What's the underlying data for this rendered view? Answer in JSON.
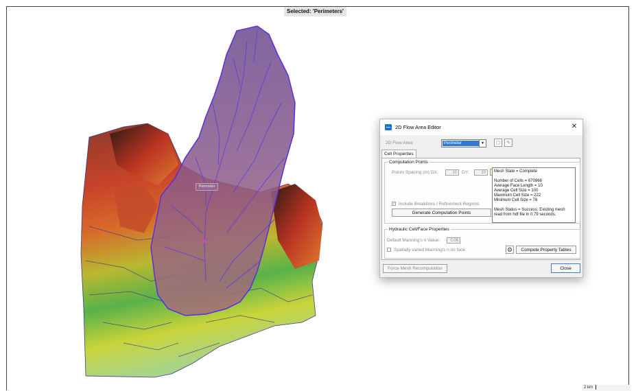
{
  "map": {
    "selected_label": "Selected: 'Perimeters'",
    "area_label": "Perimeter",
    "scale_label": "2 km"
  },
  "dialog": {
    "title": "2D Flow Area Editor",
    "app_icon": "ras-app-icon",
    "flow_area_label": "2D Flow Area:",
    "flow_area_value": "Perimeter",
    "tab_label": "Cell Properties",
    "computation_points": {
      "title": "Computation Points",
      "spacing_label": "Points Spacing (m) DX:",
      "dx": "10",
      "dy_label": "DY:",
      "dy": "10",
      "include_breaklines_label": "Include Breaklines / Refinement Regions",
      "include_breaklines_checked": true,
      "generate_button": "Generate Computation Points",
      "mesh_info": "Mesh State = Complete\n\nNumber of Cells = 670966\nAverage Face Length = 10\nAverage Cell Size = 100\nMaximum Cell Size = 222\nMinimum Cell Size = 78\n\nMesh Status = Success: Existing mesh read from hdf file in 0.79 seconds."
    },
    "hydraulic": {
      "title": "Hydraulic Cell/Face Properties",
      "mannings_label": "Default Manning's n Value:",
      "mannings_value": "0.06",
      "spatially_varied_label": "Spatially varied Manning's n on face",
      "spatially_varied_checked": false,
      "compute_button": "Compute Property Tables"
    },
    "force_button": "Force Mesh Recomputation",
    "close_button": "Close"
  }
}
